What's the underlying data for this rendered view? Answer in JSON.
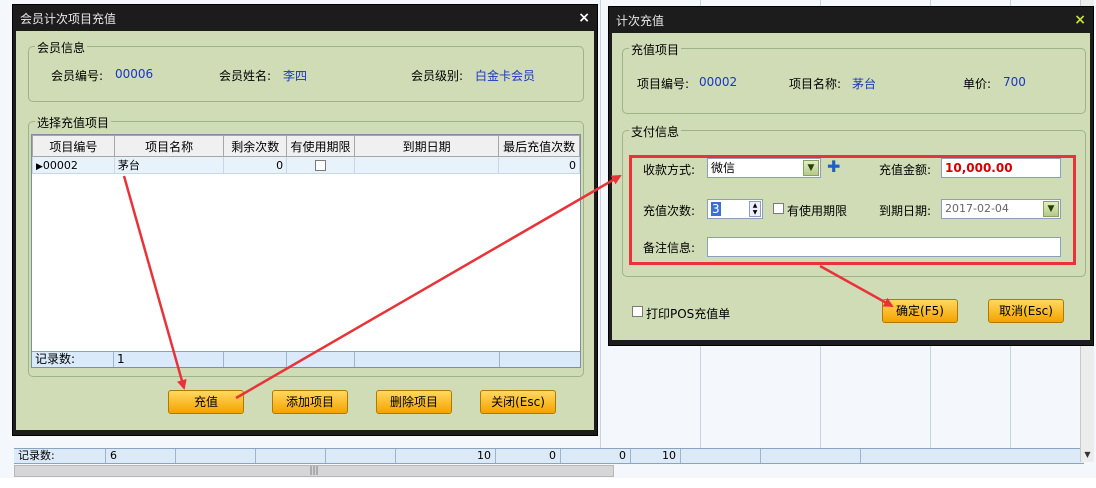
{
  "background": {
    "status_label": "记录数:",
    "status_cells": [
      "6",
      "",
      "",
      "",
      "",
      "10",
      "0",
      "0",
      "10",
      "",
      "",
      "",
      "",
      ""
    ],
    "scroll_grip": "|||"
  },
  "member_window": {
    "title": "会员计次项目充值",
    "close_glyph": "×",
    "member_group": {
      "legend": "会员信息",
      "number_label": "会员编号:",
      "number_value": "00006",
      "name_label": "会员姓名:",
      "name_value": "李四",
      "level_label": "会员级别:",
      "level_value": "白金卡会员"
    },
    "items_group": {
      "legend": "选择充值项目",
      "columns": [
        "项目编号",
        "项目名称",
        "剩余次数",
        "有使用期限",
        "到期日期",
        "最后充值次数"
      ],
      "rows": [
        {
          "indicator": "▶",
          "code": "00002",
          "name": "茅台",
          "remaining": "0",
          "limited": false,
          "expiry": "",
          "last": "0"
        }
      ],
      "footer_label": "记录数:",
      "footer_count": "1"
    },
    "buttons": {
      "recharge": "充值",
      "add_item": "添加项目",
      "delete_item": "删除项目",
      "close": "关闭(Esc)"
    }
  },
  "recharge_window": {
    "title": "计次充值",
    "close_glyph": "×",
    "item_group": {
      "legend": "充值项目",
      "code_label": "项目编号:",
      "code_value": "00002",
      "name_label": "项目名称:",
      "name_value": "茅台",
      "price_label": "单价:",
      "price_value": "700"
    },
    "payment_group": {
      "legend": "支付信息",
      "method_label": "收款方式:",
      "method_value": "微信",
      "amount_label": "充值金额:",
      "amount_value": "10,000.00",
      "count_label": "充值次数:",
      "count_value": "3",
      "limited_label": "有使用期限",
      "limited_checked": false,
      "expiry_label": "到期日期:",
      "expiry_value": "2017-02-04",
      "note_label": "备注信息:",
      "note_value": ""
    },
    "print_label": "打印POS充值单",
    "print_checked": false,
    "confirm_button": "确定(F5)",
    "cancel_button": "取消(Esc)"
  },
  "colors": {
    "window_frame": "#1c1c1c",
    "client_bg": "#cfdcb5",
    "value_blue": "#1a35c7",
    "button_orange": "#f4a300",
    "annotation_red": "#e8333a",
    "amount_red": "#d40000"
  },
  "icons": {
    "add_payment": "plus-icon",
    "dropdown": "chevron-down-icon",
    "row_indicator": "triangle-right-icon",
    "spinner": "spinner-icon"
  }
}
